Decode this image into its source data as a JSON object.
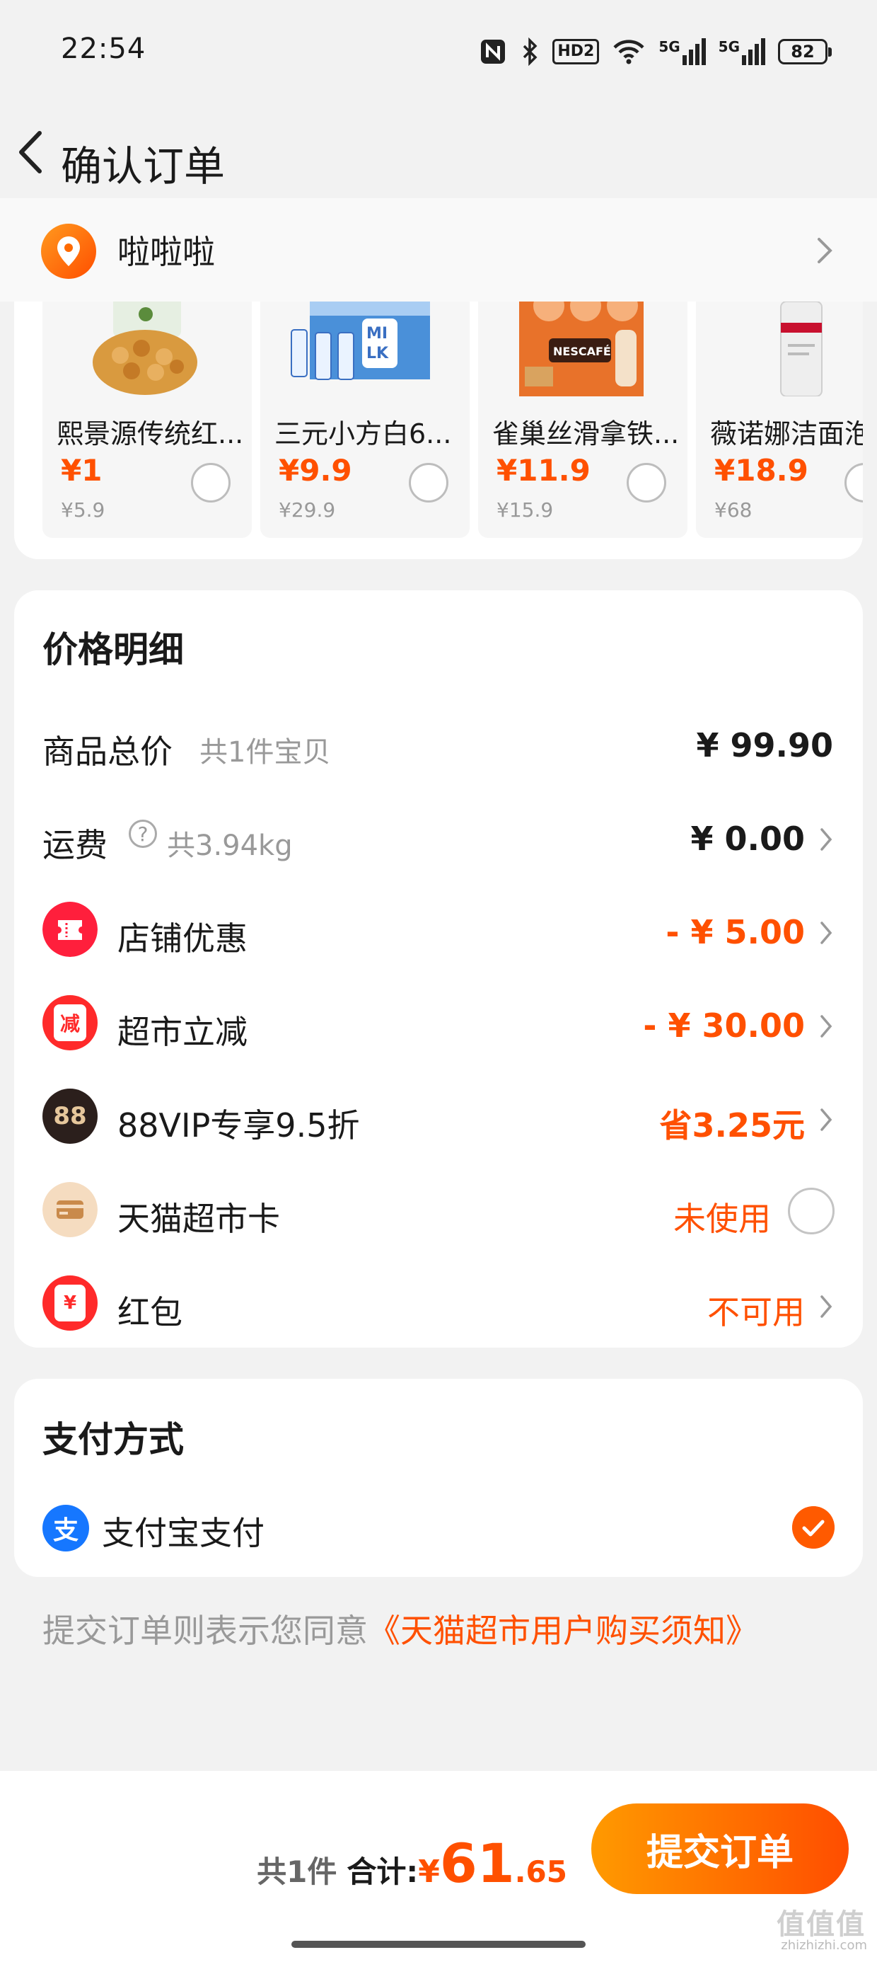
{
  "status_bar": {
    "time": "22:54",
    "battery": "82",
    "net1": "5G",
    "net2": "5G",
    "hd": "HD2"
  },
  "nav": {
    "title": "确认订单"
  },
  "address": {
    "name": "啦啦啦"
  },
  "products": [
    {
      "name": "熙景源传统红...",
      "price": "¥1",
      "original": "¥5.9",
      "image": "snack-bag-image"
    },
    {
      "name": "三元小方白6...",
      "price": "¥9.9",
      "original": "¥29.9",
      "image": "milk-box-image"
    },
    {
      "name": "雀巢丝滑拿铁...",
      "price": "¥11.9",
      "original": "¥15.9",
      "image": "nescafe-pack-image"
    },
    {
      "name": "薇诺娜洁面泡",
      "price": "¥18.9",
      "original": "¥68",
      "image": "cleanser-bottle-image"
    }
  ],
  "price_detail": {
    "title": "价格明细",
    "rows": [
      {
        "label": "商品总价",
        "sub": "共1件宝贝",
        "value": "¥ 99.90"
      },
      {
        "label": "运费",
        "sub": "共3.94kg",
        "value": "¥ 0.00",
        "help_glyph": "?"
      },
      {
        "label": "店铺优惠",
        "value": "- ¥ 5.00",
        "icon": "ticket-icon"
      },
      {
        "label": "超市立减",
        "value": "- ¥ 30.00",
        "icon": "reduce-icon",
        "icon_text": "减"
      },
      {
        "label": "88VIP专享9.5折",
        "value": "省3.25元",
        "icon": "vip88-icon",
        "icon_text": "88"
      },
      {
        "label": "天猫超市卡",
        "value": "未使用",
        "icon": "card-icon"
      },
      {
        "label": "红包",
        "value": "不可用",
        "icon": "red-packet-icon",
        "icon_text": "¥"
      }
    ]
  },
  "payment": {
    "title": "支付方式",
    "method": "支付宝支付",
    "icon_text": "支"
  },
  "notice": {
    "text": "提交订单则表示您同意",
    "link": "《天猫超市用户购买须知》"
  },
  "bottom": {
    "count": "共1件",
    "total_label": "合计:",
    "currency": "¥",
    "total_int": "61",
    "total_dec": ".65",
    "submit": "提交订单",
    "watermark": "zhizhizhi.com",
    "watermark_logo": "值值值"
  },
  "colors": {
    "accent": "#ff5000",
    "background": "#f2f2f2"
  }
}
